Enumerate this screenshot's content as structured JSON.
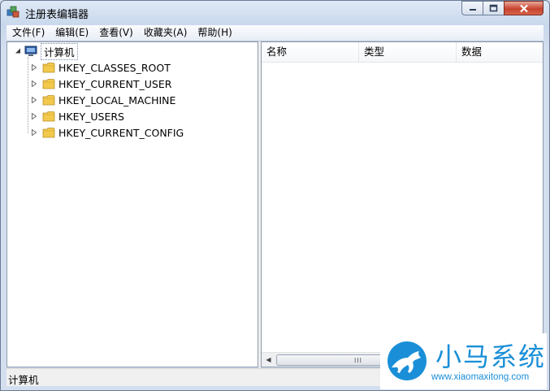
{
  "window": {
    "title": "注册表编辑器"
  },
  "menu": [
    {
      "label": "文件(F)"
    },
    {
      "label": "编辑(E)"
    },
    {
      "label": "查看(V)"
    },
    {
      "label": "收藏夹(A)"
    },
    {
      "label": "帮助(H)"
    }
  ],
  "tree": {
    "root": {
      "label": "计算机",
      "expanded": true
    },
    "keys": [
      {
        "label": "HKEY_CLASSES_ROOT"
      },
      {
        "label": "HKEY_CURRENT_USER"
      },
      {
        "label": "HKEY_LOCAL_MACHINE"
      },
      {
        "label": "HKEY_USERS"
      },
      {
        "label": "HKEY_CURRENT_CONFIG"
      }
    ]
  },
  "list": {
    "columns": [
      {
        "label": "名称"
      },
      {
        "label": "类型"
      },
      {
        "label": "数据"
      }
    ],
    "scroll_grip": "III"
  },
  "status": {
    "text": "计算机"
  },
  "watermark": {
    "title": "小马系统",
    "url": "www.xiaomaxitong.com"
  },
  "colors": {
    "accent": "#1a8fd8",
    "close_button": "#c7432e",
    "folder": "#f2c94c"
  },
  "icons": {
    "app": "registry-editor-icon",
    "computer": "computer-icon",
    "folder": "folder-icon",
    "collapsed": "triangle-right-icon",
    "expanded": "triangle-down-icon"
  }
}
